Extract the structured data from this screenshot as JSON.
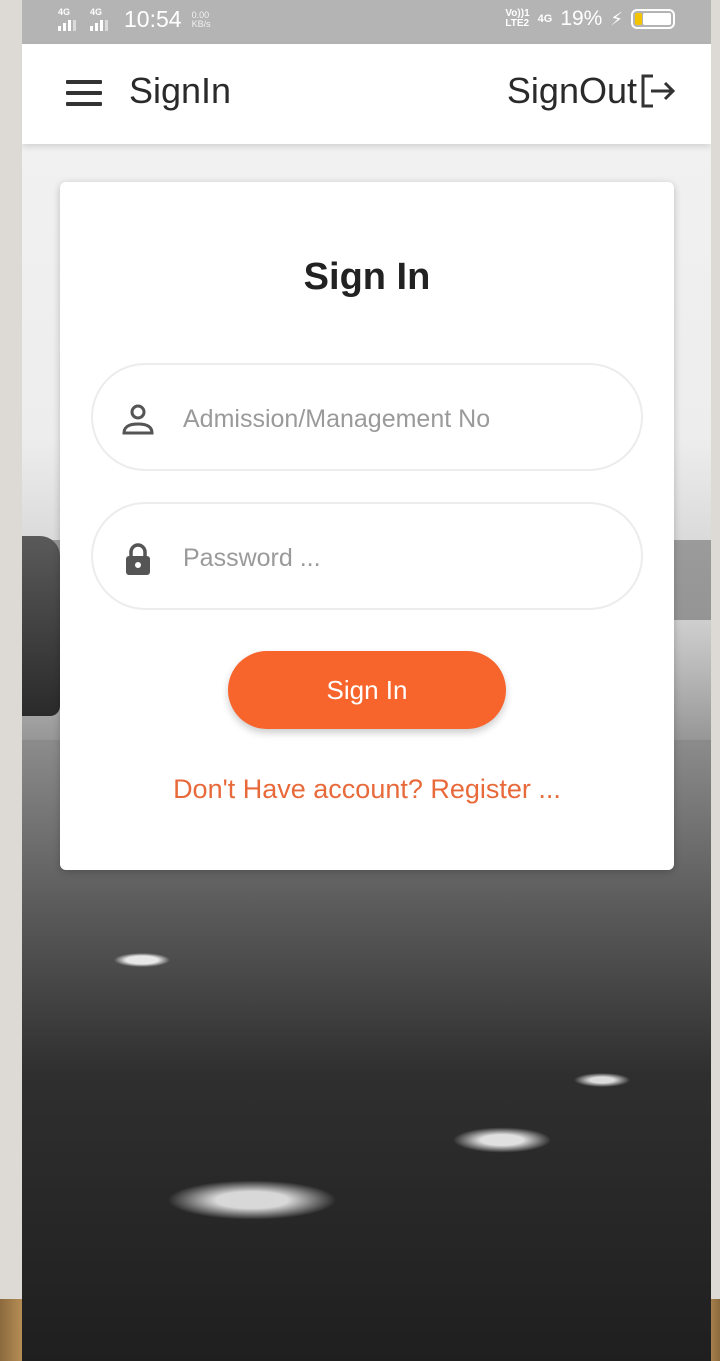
{
  "status_bar": {
    "network_1": "4G",
    "network_2": "4G",
    "time": "10:54",
    "data_rate_value": "0.00",
    "data_rate_unit": "KB/s",
    "volte": "Vo))1",
    "lte": "LTE2",
    "network_3": "4G",
    "battery_percent": "19%",
    "battery_level": 0.19,
    "charging": true
  },
  "app_bar": {
    "title": "SignIn",
    "signout_label": "SignOut",
    "menu_icon": "hamburger-icon",
    "signout_icon": "sign-out-icon"
  },
  "form": {
    "title": "Sign In",
    "username": {
      "placeholder": "Admission/Management No",
      "value": "",
      "icon": "user-icon"
    },
    "password": {
      "placeholder": "Password ...",
      "value": "",
      "icon": "lock-icon"
    },
    "submit_label": "Sign In",
    "register_link": "Don't Have account? Register ..."
  },
  "colors": {
    "accent": "#f7652d",
    "link": "#e86a3b",
    "status_bar": "#b4b4b4",
    "app_bar": "#ffffff"
  }
}
